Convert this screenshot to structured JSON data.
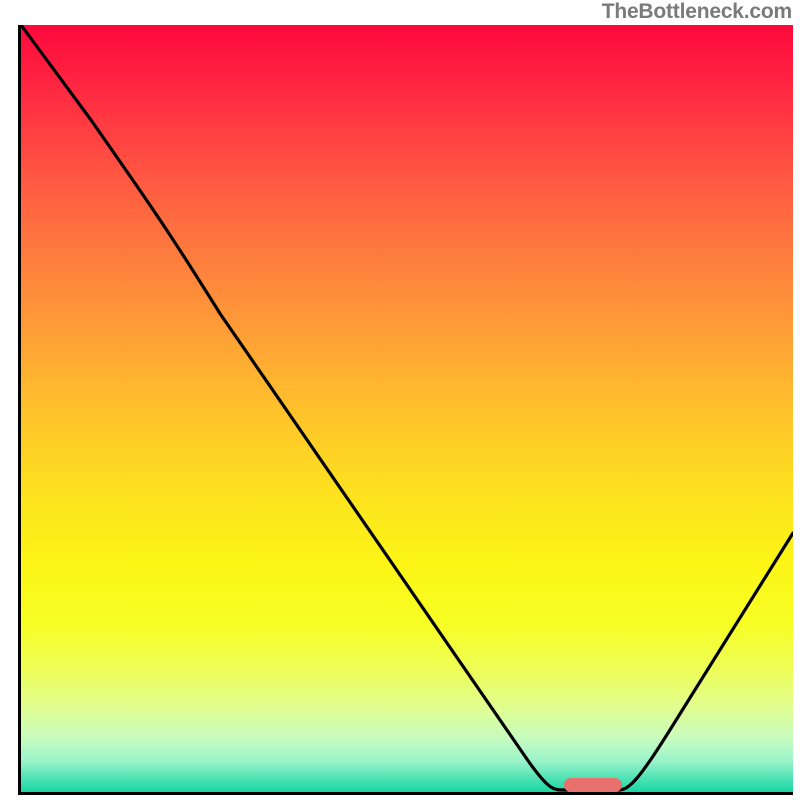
{
  "watermark": "TheBottleneck.com",
  "chart_data": {
    "type": "line",
    "title": "",
    "xlabel": "",
    "ylabel": "",
    "x": [
      0,
      0.05,
      0.1,
      0.15,
      0.2,
      0.25,
      0.3,
      0.35,
      0.4,
      0.45,
      0.5,
      0.55,
      0.6,
      0.65,
      0.7,
      0.72,
      0.75,
      0.78,
      0.8,
      0.85,
      0.9,
      0.95,
      1.0
    ],
    "values": [
      1.0,
      0.92,
      0.84,
      0.76,
      0.69,
      0.62,
      0.55,
      0.47,
      0.4,
      0.33,
      0.26,
      0.19,
      0.12,
      0.05,
      0.005,
      0.0,
      0.0,
      0.0,
      0.01,
      0.06,
      0.12,
      0.19,
      0.26
    ],
    "xlim": [
      0,
      1
    ],
    "ylim": [
      0,
      1
    ],
    "marker": {
      "x_start": 0.7,
      "x_end": 0.78,
      "y": 0.0
    },
    "gradient_colors": [
      "#fd083c",
      "#fec12c",
      "#fcf516",
      "#19d6a3"
    ]
  }
}
